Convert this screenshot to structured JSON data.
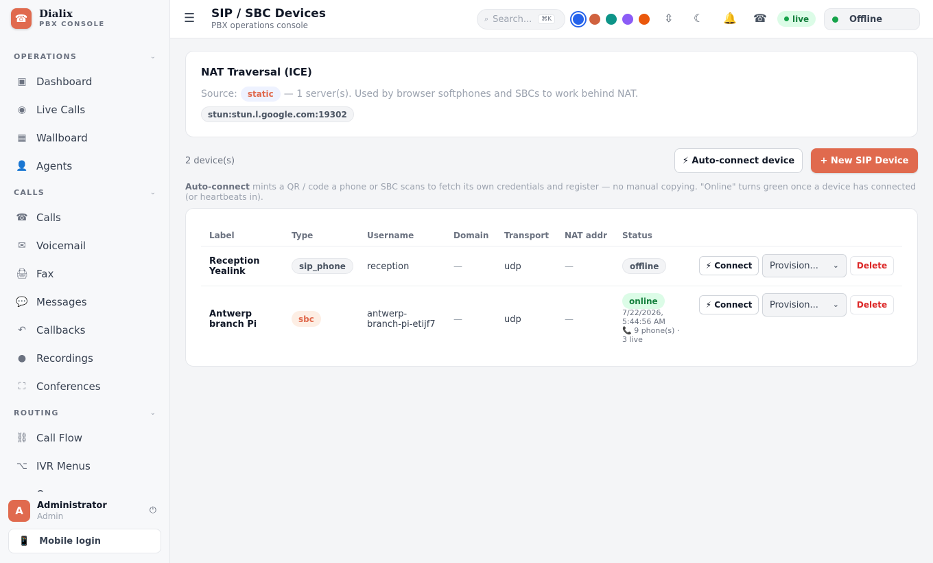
{
  "brand": {
    "name": "Dialix",
    "subtitle": "PBX CONSOLE",
    "logo_icon": "phone-icon"
  },
  "sidebar": {
    "sections": [
      {
        "title": "OPERATIONS",
        "items": [
          {
            "label": "Dashboard",
            "icon": "dashboard-icon",
            "glyph": "▣"
          },
          {
            "label": "Live Calls",
            "icon": "live-calls-icon",
            "glyph": "◉"
          },
          {
            "label": "Wallboard",
            "icon": "wallboard-icon",
            "glyph": "▦"
          },
          {
            "label": "Agents",
            "icon": "agents-icon",
            "glyph": "👤"
          }
        ]
      },
      {
        "title": "CALLS",
        "items": [
          {
            "label": "Calls",
            "icon": "calls-icon",
            "glyph": "☎"
          },
          {
            "label": "Voicemail",
            "icon": "voicemail-icon",
            "glyph": "✉"
          },
          {
            "label": "Fax",
            "icon": "fax-icon",
            "glyph": "🖨"
          },
          {
            "label": "Messages",
            "icon": "messages-icon",
            "glyph": "💬"
          },
          {
            "label": "Callbacks",
            "icon": "callbacks-icon",
            "glyph": "↶"
          },
          {
            "label": "Recordings",
            "icon": "recordings-icon",
            "glyph": "●"
          },
          {
            "label": "Conferences",
            "icon": "conferences-icon",
            "glyph": "⛶"
          }
        ]
      },
      {
        "title": "ROUTING",
        "items": [
          {
            "label": "Call Flow",
            "icon": "call-flow-icon",
            "glyph": "⛓"
          },
          {
            "label": "IVR Menus",
            "icon": "ivr-menus-icon",
            "glyph": "⌥"
          },
          {
            "label": "Queues",
            "icon": "queues-icon",
            "glyph": "≡"
          }
        ]
      }
    ],
    "user": {
      "initial": "A",
      "name": "Administrator",
      "role": "Admin"
    },
    "mobile_login": "Mobile login"
  },
  "header": {
    "title": "SIP / SBC Devices",
    "subtitle": "PBX operations console",
    "search_placeholder": "Search...",
    "search_shortcut": "⌘K",
    "theme_colors": [
      "#2563eb",
      "#d0623f",
      "#0d9488",
      "#8b5cf6",
      "#ea580c"
    ],
    "live_label": "live",
    "presence_status": "Offline"
  },
  "nat": {
    "title": "NAT Traversal (ICE)",
    "source_label": "Source:",
    "source_value": "static",
    "description": "— 1 server(s). Used by browser softphones and SBCs to work behind NAT.",
    "server": "stun:stun.l.google.com:19302"
  },
  "devices": {
    "count_label": "2 device(s)",
    "auto_connect_label": "⚡ Auto-connect device",
    "new_device_label": "+ New SIP Device",
    "hint_bold": "Auto-connect",
    "hint_text": " mints a QR / code a phone or SBC scans to fetch its own credentials and register — no manual copying. \"Online\" turns green once a device has connected (or heartbeats in).",
    "columns": [
      "Label",
      "Type",
      "Username",
      "Domain",
      "Transport",
      "NAT addr",
      "Status"
    ],
    "rows": [
      {
        "label_1": "Reception",
        "label_2": "Yealink",
        "type": "sip_phone",
        "username_1": "reception",
        "username_2": "",
        "domain": "—",
        "transport": "udp",
        "nat_addr": "—",
        "status": "offline",
        "status_time_1": "",
        "status_time_2": "",
        "status_phones_1": "",
        "status_phones_2": "",
        "connect": "⚡ Connect",
        "provision": "Provision...",
        "delete": "Delete"
      },
      {
        "label_1": "Antwerp",
        "label_2": "branch Pi",
        "type": "sbc",
        "username_1": "antwerp-",
        "username_2": "branch-pi-etijf7",
        "domain": "—",
        "transport": "udp",
        "nat_addr": "—",
        "status": "online",
        "status_time_1": "7/22/2026,",
        "status_time_2": "5:44:56 AM",
        "status_phones_1": "📞 9 phone(s) ·",
        "status_phones_2": "3 live",
        "connect": "⚡ Connect",
        "provision": "Provision...",
        "delete": "Delete"
      }
    ]
  }
}
